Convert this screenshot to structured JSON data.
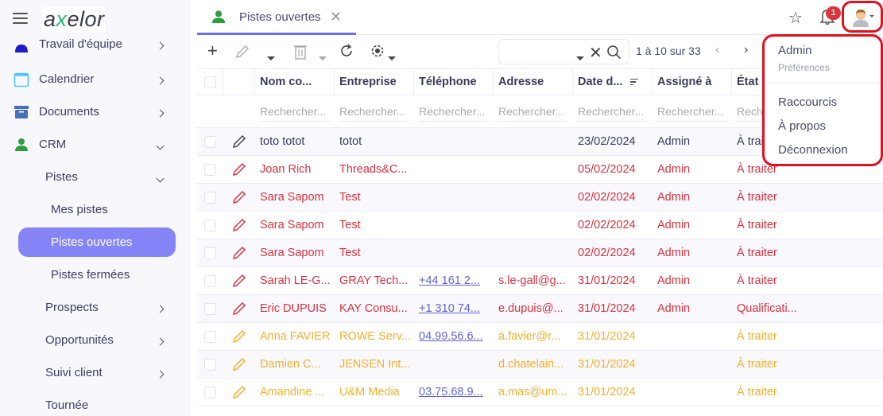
{
  "sidebar": {
    "logo": {
      "pre": "a",
      "x": "x",
      "post": "elor"
    },
    "items": [
      {
        "label": "Travail d'équipe",
        "icon": "team-icon",
        "color": "#1d1dc9"
      },
      {
        "label": "Calendrier",
        "icon": "calendar-icon",
        "color": "#4fc3f7"
      },
      {
        "label": "Documents",
        "icon": "archive-icon",
        "color": "#4a6fb5"
      },
      {
        "label": "CRM",
        "icon": "person-icon",
        "color": "#2e9e3e"
      }
    ],
    "crm_sub": [
      {
        "label": "Pistes"
      },
      {
        "label": "Mes pistes"
      },
      {
        "label": "Pistes ouvertes"
      },
      {
        "label": "Pistes fermées"
      },
      {
        "label": "Prospects"
      },
      {
        "label": "Opportunités"
      },
      {
        "label": "Suivi client"
      },
      {
        "label": "Tournée"
      }
    ]
  },
  "tab": {
    "label": "Pistes ouvertes"
  },
  "notifications": {
    "count": "1"
  },
  "search": {
    "value": "",
    "placeholder": ""
  },
  "pager": {
    "text": "1 à 10 sur 33"
  },
  "grid": {
    "headers": [
      "Nom co...",
      "Entreprise",
      "Téléphone",
      "Adresse",
      "Date d...",
      "Assigné à",
      "État"
    ],
    "filter_placeholder": "Rechercher...",
    "rows": [
      {
        "color": "normal",
        "name": "toto totot",
        "company": "totot",
        "phone": "",
        "address": "",
        "date": "23/02/2024",
        "assigned": "Admin",
        "state": "À traiter"
      },
      {
        "color": "red",
        "name": "Joan Rich",
        "company": "Threads&C...",
        "phone": "",
        "address": "",
        "date": "05/02/2024",
        "assigned": "Admin",
        "state": "À traiter"
      },
      {
        "color": "red",
        "name": "Sara Sapom",
        "company": "Test",
        "phone": "",
        "address": "",
        "date": "02/02/2024",
        "assigned": "Admin",
        "state": "À traiter"
      },
      {
        "color": "red",
        "name": "Sara Sapom",
        "company": "Test",
        "phone": "",
        "address": "",
        "date": "02/02/2024",
        "assigned": "Admin",
        "state": "À traiter"
      },
      {
        "color": "red",
        "name": "Sara Sapom",
        "company": "Test",
        "phone": "",
        "address": "",
        "date": "02/02/2024",
        "assigned": "Admin",
        "state": "À traiter"
      },
      {
        "color": "red",
        "name": "Sarah LE-G...",
        "company": "GRAY Tech...",
        "phone": "+44 161 2...",
        "address": "s.le-gall@g...",
        "date": "31/01/2024",
        "assigned": "Admin",
        "state": "À traiter"
      },
      {
        "color": "red",
        "name": "Eric DUPUIS",
        "company": "KAY Consu...",
        "phone": "+1 310 74...",
        "address": "e.dupuis@...",
        "date": "31/01/2024",
        "assigned": "Admin",
        "state": "Qualificati..."
      },
      {
        "color": "orange",
        "name": "Anna FAVIER",
        "company": "ROWE Serv...",
        "phone": "04.99.56.6...",
        "address": "a.favier@r...",
        "date": "31/01/2024",
        "assigned": "",
        "state": "À traiter"
      },
      {
        "color": "orange",
        "name": "Damien C...",
        "company": "JENSEN Int...",
        "phone": "",
        "address": "d.chatelain...",
        "date": "31/01/2024",
        "assigned": "",
        "state": "À traiter"
      },
      {
        "color": "orange",
        "name": "Amandine ...",
        "company": "U&M Media",
        "phone": "03.75.68.9...",
        "address": "a.mas@um...",
        "date": "31/01/2024",
        "assigned": "",
        "state": "À traiter"
      }
    ]
  },
  "user_menu": {
    "name": "Admin",
    "preferences": "Préférences",
    "shortcuts": "Raccourcis",
    "about": "À propos",
    "logout": "Déconnexion"
  },
  "colors": {
    "accent": "#6f6ff0",
    "active_pill": "#8585f8",
    "red_row": "#d8323f",
    "orange_row": "#f5b02b",
    "highlight": "#e0101e",
    "badge": "#d9363e"
  }
}
